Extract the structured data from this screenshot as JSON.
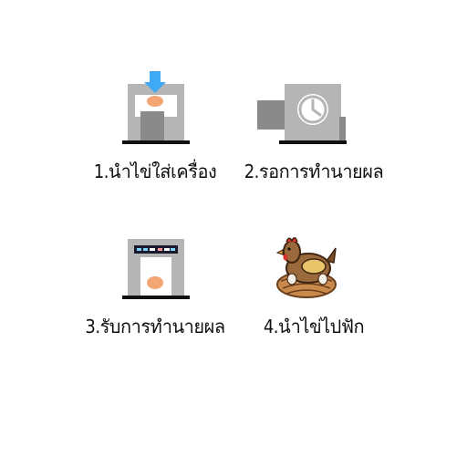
{
  "steps": [
    {
      "label": "1.นำไข่ใส่เครื่อง",
      "icon": "machine-insert-egg-icon"
    },
    {
      "label": "2.รอการทำนายผล",
      "icon": "machine-wait-clock-icon"
    },
    {
      "label": "3.รับการทำนายผล",
      "icon": "machine-result-egg-icon"
    },
    {
      "label": "4.นำไข่ไปฟัก",
      "icon": "hen-on-nest-icon"
    }
  ],
  "colors": {
    "machine": "#b5b5b5",
    "machine_dark": "#8a8a8a",
    "base": "#111111",
    "arrow": "#3fa9f5",
    "egg": "#f4a574",
    "hen_body": "#9a6a3c",
    "hen_comb": "#d9342b",
    "hen_wing": "#e8c46a",
    "nest": "#c98a4b"
  }
}
